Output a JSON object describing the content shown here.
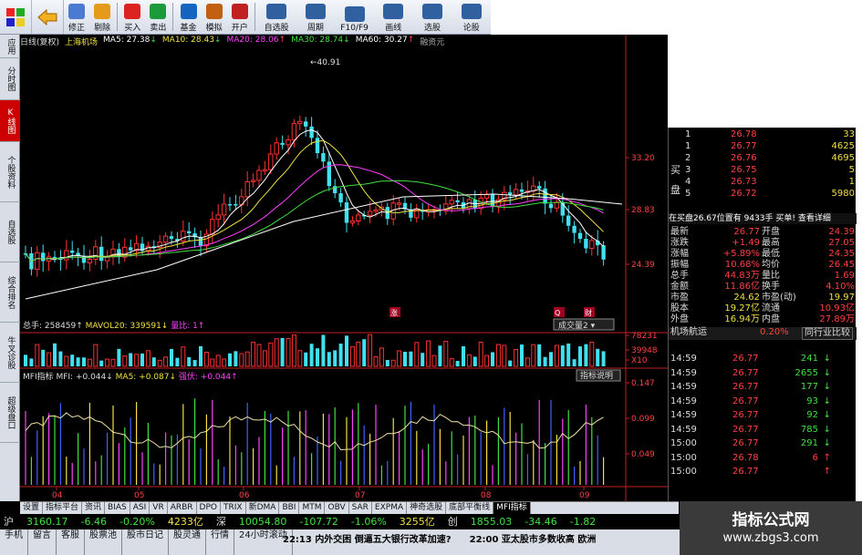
{
  "toolbar": {
    "big_icons": [
      "grid-icon",
      "back-arrow-icon"
    ],
    "buttons": [
      {
        "name": "modify-button",
        "icon": "up-arrow-icon",
        "label": "修正",
        "color": "#4a7bd0"
      },
      {
        "name": "clear-button",
        "icon": "clock-icon",
        "label": "剔除",
        "color": "#e69a1a"
      },
      {
        "name": "buy-button",
        "icon": "buy-icon",
        "label": "买入",
        "color": "#d22"
      },
      {
        "name": "sell-button",
        "icon": "sell-icon",
        "label": "卖出",
        "color": "#1a9a3a"
      },
      {
        "name": "fund-button",
        "icon": "fund-icon",
        "label": "基金",
        "color": "#1565c0"
      },
      {
        "name": "simulate-button",
        "icon": "hammer-icon",
        "label": "模拟",
        "color": "#c06010"
      },
      {
        "name": "open-button",
        "icon": "door-icon",
        "label": "开户",
        "color": "#c02020"
      }
    ],
    "wide": [
      {
        "name": "watchlist-button",
        "label": "自选股",
        "color": "#3060a0"
      },
      {
        "name": "period-button",
        "label": "周期",
        "color": "#3060a0"
      },
      {
        "name": "f10-button",
        "label": "F10/F9",
        "color": "#3060a0"
      },
      {
        "name": "draw-button",
        "label": "画线",
        "color": "#3060a0"
      },
      {
        "name": "select-stock-button",
        "label": "选股",
        "color": "#3060a0"
      },
      {
        "name": "forum-button",
        "label": "论股",
        "color": "#3060a0"
      }
    ]
  },
  "left_tabs": [
    {
      "name": "tab-apply",
      "label": "应用"
    },
    {
      "name": "tab-timeshare",
      "label": "分时图"
    },
    {
      "name": "tab-kline",
      "label": "K线图",
      "active": true
    },
    {
      "name": "tab-stock-info",
      "label": "个股资料"
    },
    {
      "name": "tab-watchlist",
      "label": "自选股"
    },
    {
      "name": "tab-ranking",
      "label": "综合排名"
    },
    {
      "name": "tab-niuwen",
      "label": "牛叉诊股"
    },
    {
      "name": "tab-market",
      "label": "超级盘口"
    }
  ],
  "chart": {
    "period": "日线(复权)",
    "stock": "上海机场",
    "ma": [
      {
        "label": "MA5: 27.38",
        "arrow": "↓",
        "color": "#ffffff"
      },
      {
        "label": "MA10: 28.43",
        "arrow": "↓",
        "color": "#f0e040"
      },
      {
        "label": "MA20: 28.06",
        "arrow": "↑",
        "color": "#ff40ff"
      },
      {
        "label": "MA30: 28.74",
        "arrow": "↓",
        "color": "#40e040"
      },
      {
        "label": "MA60: 30.27",
        "arrow": "↑",
        "color": "#ffffff"
      }
    ],
    "extra": "融资元",
    "high_label": "40.91",
    "price_ticks": [
      "33.20",
      "28.83",
      "24.39"
    ],
    "vol_ticks": [
      "78231",
      "39948",
      "X10"
    ],
    "mfi_ticks": [
      "0.147",
      "0.099",
      "0.049"
    ],
    "months": [
      "04",
      "05",
      "06",
      "07",
      "08",
      "09"
    ],
    "vol_title": {
      "a": "总手: 258459",
      "b": "MAVOL20: 339591",
      "c": "量比: 1"
    },
    "vol_select": "成交量2",
    "mfi_title": {
      "a": "MFI指标  MFI: +0.044",
      "b": "MA5: +0.087",
      "c": "强伏: +0.044"
    },
    "mfi_button": "指标说明",
    "markers": [
      "涨",
      "Q",
      "财"
    ],
    "colors": {
      "up": "#ff3030",
      "down": "#40e0f0",
      "axis": "#c02020"
    }
  },
  "order_book": {
    "side_label": [
      "买",
      "盘"
    ],
    "rows": [
      {
        "lv": "1",
        "price": "26.78",
        "vol": "33"
      },
      {
        "lv": "1",
        "price": "26.77",
        "vol": "4625"
      },
      {
        "lv": "2",
        "price": "26.76",
        "vol": "4695"
      },
      {
        "lv": "3",
        "price": "26.75",
        "vol": "5"
      },
      {
        "lv": "4",
        "price": "26.73",
        "vol": "1"
      },
      {
        "lv": "5",
        "price": "26.72",
        "vol": "5980"
      }
    ],
    "notice": "在买盘26.67位置有 9433手 买单! 查看详细"
  },
  "quote": [
    {
      "a": "最新",
      "b": "26.77",
      "c": "开盘",
      "d": "24.39"
    },
    {
      "a": "涨跌",
      "b": "+1.49",
      "c": "最高",
      "d": "27.05"
    },
    {
      "a": "涨幅",
      "b": "+5.89%",
      "c": "最低",
      "d": "24.35"
    },
    {
      "a": "振幅",
      "b": "10.68%",
      "c": "均价",
      "d": "26.45"
    },
    {
      "a": "总手",
      "b": "44.83万",
      "c": "量比",
      "d": "1.69"
    },
    {
      "a": "金额",
      "b": "11.86亿",
      "c": "换手",
      "d": "4.10%"
    },
    {
      "a": "市盈",
      "b": "24.62",
      "c": "市盈(动)",
      "d": "19.97"
    },
    {
      "a": "股本",
      "b": "19.27亿",
      "c": "流通",
      "d": "10.93亿"
    },
    {
      "a": "外盘",
      "b": "16.94万",
      "c": "内盘",
      "d": "27.89万"
    }
  ],
  "sector": {
    "name": "机场航运",
    "pct": "0.20%",
    "compare": "同行业比较"
  },
  "ticks": [
    {
      "t": "14:59",
      "p": "26.77",
      "v": "241",
      "dir": "down"
    },
    {
      "t": "14:59",
      "p": "26.77",
      "v": "2655",
      "dir": "down"
    },
    {
      "t": "14:59",
      "p": "26.77",
      "v": "177",
      "dir": "down"
    },
    {
      "t": "14:59",
      "p": "26.77",
      "v": "93",
      "dir": "down"
    },
    {
      "t": "14:59",
      "p": "26.77",
      "v": "92",
      "dir": "down"
    },
    {
      "t": "14:59",
      "p": "26.77",
      "v": "785",
      "dir": "down"
    },
    {
      "t": "15:00",
      "p": "26.77",
      "v": "291",
      "dir": "down"
    },
    {
      "t": "15:00",
      "p": "26.78",
      "v": "6",
      "dir": "up"
    },
    {
      "t": "15:00",
      "p": "26.77",
      "v": "",
      "dir": "up"
    }
  ],
  "bottom_tabs": [
    "设置",
    "指标平台",
    "资讯",
    "BIAS",
    "ASI",
    "VR",
    "ARBR",
    "DPO",
    "TRIX",
    "新DMA",
    "BBI",
    "MTM",
    "OBV",
    "SAR",
    "EXPMA",
    "神奇选股",
    "底部平衡线",
    "MFI指标"
  ],
  "index_bar": {
    "sh_label": "沪",
    "sh_val": "3160.17",
    "sh_chg": "-6.46",
    "sh_pct": "-0.20%",
    "sh_amt": "4233亿",
    "sz_label": "深",
    "sz_val": "10054.80",
    "sz_chg": "-107.72",
    "sz_pct": "-1.06%",
    "sz_amt": "3255亿",
    "cy_label": "创",
    "cy_val": "1855.03",
    "cy_chg": "-34.46",
    "cy_pct": "-1.82"
  },
  "bottom_bar": [
    "手机",
    "留言",
    "客服",
    "股票池",
    "股市日记",
    "股灵通",
    "行情",
    "24小时滚动"
  ],
  "news": [
    "22:13 内外交困 倒逼五大银行改革加速?",
    "22:00 亚太股市多数收高 欧洲"
  ],
  "watermark": {
    "t1": "指标公式网",
    "t2": "www.zbgs3.com"
  }
}
